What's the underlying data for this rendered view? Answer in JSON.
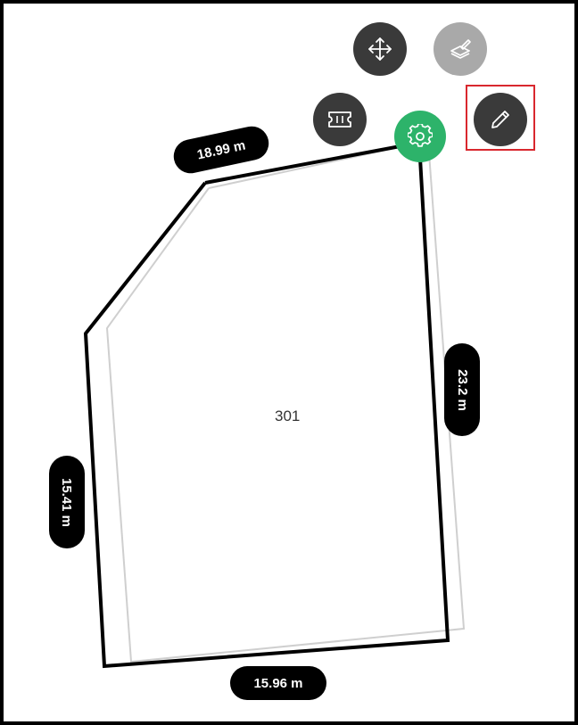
{
  "plot": {
    "id_label": "301"
  },
  "measurements": {
    "top": "18.99 m",
    "right": "23.2 m",
    "left": "15.41 m",
    "bottom": "15.96 m"
  },
  "toolbar": {
    "move": "move-icon",
    "layers": "layers-stack-icon",
    "ticket": "ticket-icon",
    "settings": "gear-icon",
    "edit": "pencil-icon"
  },
  "colors": {
    "settings_accent": "#2db36a",
    "button_dark": "#3a3a3a",
    "button_disabled": "#a9a9a9",
    "highlight": "#d9272e"
  }
}
